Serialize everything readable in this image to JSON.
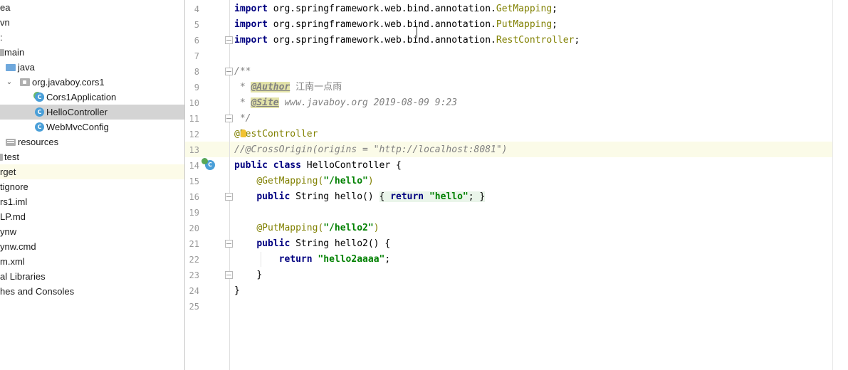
{
  "project_tree": {
    "items": [
      {
        "label": "ea",
        "name": "tree-item-idea",
        "icon": "folder"
      },
      {
        "label": "vn",
        "name": "tree-item-mvn",
        "icon": "folder"
      },
      {
        "label": ":",
        "name": "tree-item-src",
        "icon": "folder"
      },
      {
        "label": "main",
        "name": "tree-item-main",
        "icon": "folder"
      },
      {
        "label": "java",
        "name": "tree-item-java",
        "icon": "folder-source"
      },
      {
        "label": "org.javaboy.cors1",
        "name": "tree-item-package",
        "icon": "package"
      },
      {
        "label": "Cors1Application",
        "name": "tree-item-cors1application",
        "icon": "spring-app-class"
      },
      {
        "label": "HelloController",
        "name": "tree-item-hellocontroller",
        "icon": "class"
      },
      {
        "label": "WebMvcConfig",
        "name": "tree-item-webmvcconfig",
        "icon": "class"
      },
      {
        "label": "resources",
        "name": "tree-item-resources",
        "icon": "folder-resources"
      },
      {
        "label": "test",
        "name": "tree-item-test",
        "icon": "folder"
      },
      {
        "label": "rget",
        "name": "tree-item-target",
        "icon": "folder"
      },
      {
        "label": "tignore",
        "name": "tree-item-gitignore",
        "icon": "file"
      },
      {
        "label": "rs1.iml",
        "name": "tree-item-iml",
        "icon": "file"
      },
      {
        "label": "LP.md",
        "name": "tree-item-help-md",
        "icon": "file"
      },
      {
        "label": "ynw",
        "name": "tree-item-mvnw",
        "icon": "file"
      },
      {
        "label": "ynw.cmd",
        "name": "tree-item-mvnw-cmd",
        "icon": "file"
      },
      {
        "label": "m.xml",
        "name": "tree-item-pom",
        "icon": "file"
      },
      {
        "label": "al Libraries",
        "name": "tree-item-external-libraries",
        "icon": "library"
      },
      {
        "label": "hes and Consoles",
        "name": "tree-item-scratches",
        "icon": "scratch"
      }
    ],
    "selected": "HelloController",
    "class_icon_letter": "C"
  },
  "editor": {
    "line_numbers": [
      "4",
      "5",
      "6",
      "7",
      "8",
      "9",
      "10",
      "11",
      "12",
      "13",
      "14",
      "15",
      "16",
      "19",
      "20",
      "21",
      "22",
      "23",
      "24",
      "25"
    ],
    "tokens": {
      "import": "import",
      "pkg_prefix": " org.springframework.web.bind.annotation.",
      "get_mapping_cls": "GetMapping",
      "put_mapping_cls": "PutMapping",
      "rest_controller_cls": "RestController",
      "semi": ";",
      "doc_open": "/**",
      "doc_star": " * ",
      "author_tag": "@Author",
      "author_value": "江南一点雨",
      "site_tag": "@Site",
      "site_value": " www.javaboy.org 2019-08-09 9:23",
      "doc_close": " */",
      "rest_controller_ann": "@RestController",
      "cross_origin_comment": "//@CrossOrigin(origins = \"http://localhost:8081\")",
      "public": "public",
      "class": "class",
      "class_name": " HelloController {",
      "get_mapping_ann": "@GetMapping(",
      "hello_path": "\"/hello\"",
      "close_paren": ")",
      "string_hello": " String hello() ",
      "open_brace": "{ ",
      "return": "return",
      "hello_str": "\"hello\"",
      "semi_close": "; }",
      "put_mapping_ann": "@PutMapping(",
      "hello2_path": "\"/hello2\"",
      "string_hello2": " String hello2() {",
      "hello2aaaa_str": "\"hello2aaaa\"",
      "close_brace": "}"
    }
  },
  "colors": {
    "keyword": "#000080",
    "annotation": "#808000",
    "string": "#008000",
    "comment": "#808080",
    "current_line": "#fbfbe8",
    "selection": "#d4d4d4"
  }
}
